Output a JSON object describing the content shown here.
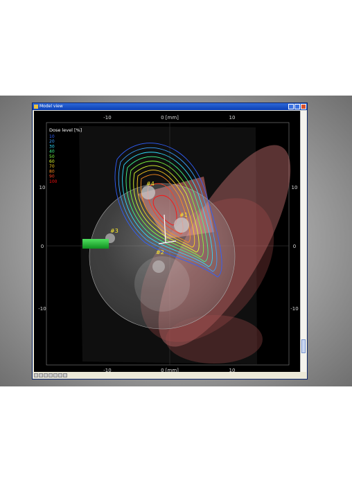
{
  "window": {
    "title": "Model view"
  },
  "axis": {
    "top_ticks": [
      "-10",
      "0 [mm]",
      "10"
    ],
    "bottom_ticks": [
      "-10",
      "0 [mm]",
      "10"
    ],
    "left_ticks": [
      "10",
      "0",
      "-10"
    ],
    "right_ticks": [
      "10",
      "0",
      "-10"
    ]
  },
  "legend": {
    "title": "Dose level [%]",
    "items": [
      {
        "label": "10",
        "color": "#3060ff"
      },
      {
        "label": "20",
        "color": "#3aa0ff"
      },
      {
        "label": "30",
        "color": "#30e0ff"
      },
      {
        "label": "40",
        "color": "#40ff90"
      },
      {
        "label": "50",
        "color": "#80ff40"
      },
      {
        "label": "60",
        "color": "#e0ff30"
      },
      {
        "label": "70",
        "color": "#ffd020"
      },
      {
        "label": "80",
        "color": "#ff9020"
      },
      {
        "label": "90",
        "color": "#ff4020"
      },
      {
        "label": "100",
        "color": "#ff1010"
      }
    ]
  },
  "markers": [
    "#1",
    "#2",
    "#3",
    "#4"
  ],
  "colors": {
    "marker_text": "#ffee30",
    "needle": "#20b030"
  }
}
